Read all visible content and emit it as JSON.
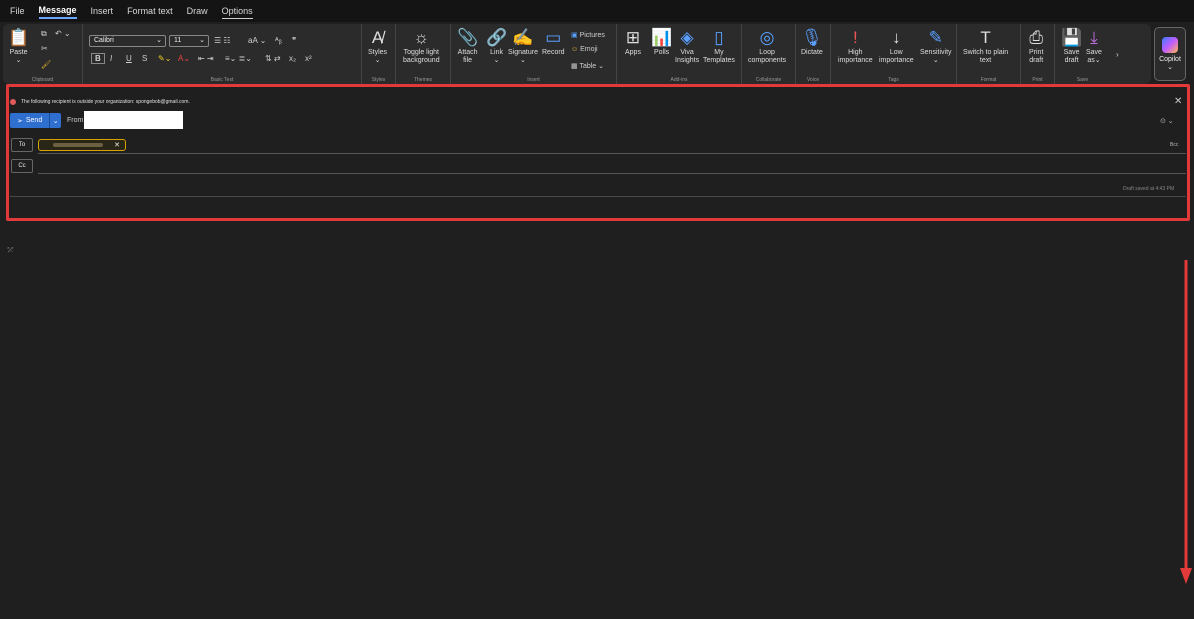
{
  "menu": [
    "File",
    "Message",
    "Insert",
    "Format text",
    "Draw",
    "Options"
  ],
  "ribbon": {
    "clipboard": {
      "paste": "Paste",
      "group": "Clipboard"
    },
    "basic_text": {
      "font": "Calibri",
      "size": "11",
      "group": "Basic Text"
    },
    "styles": {
      "label": "Styles",
      "group": "Styles"
    },
    "toggle": {
      "label1": "Toggle light",
      "label2": "background",
      "group": "Themes"
    },
    "include": {
      "attach1": "Attach",
      "attach2": "file",
      "link": "Link",
      "signature": "Signature",
      "record": "Record",
      "pictures": "Pictures",
      "emoji": "Emoji",
      "table": "Table",
      "group": "Insert"
    },
    "addins": {
      "apps": "Apps",
      "polls": "Polls",
      "viva1": "Viva",
      "viva2": "Insights",
      "my1": "My",
      "my2": "Templates",
      "group": "Add-ins"
    },
    "loop": {
      "label1": "Loop",
      "label2": "components",
      "group": "Collaborate"
    },
    "dictate": {
      "label": "Dictate",
      "group": "Voice"
    },
    "tags": {
      "high1": "High",
      "high2": "importance",
      "low1": "Low",
      "low2": "importance",
      "sens": "Sensitivity",
      "group": "Tags"
    },
    "format": {
      "label1": "Switch to plain",
      "label2": "text",
      "group": "Format"
    },
    "print": {
      "label1": "Print",
      "label2": "draft",
      "group": "Print"
    },
    "save": {
      "save1": "Save",
      "save2": "draft",
      "saveas1": "Save",
      "saveas2": "as",
      "group": "Save"
    },
    "copilot": "Copilot"
  },
  "compose": {
    "warning": "The following recipient is outside your organization: spongebob@gmail.com.",
    "send": "Send",
    "from": "From",
    "to": "To",
    "cc": "Cc",
    "bcc": "Bcc",
    "draft_saved": "Draft saved at 4:43 PM"
  },
  "colors": {
    "highlight": "#e23a3a",
    "accent": "#2f6fd0",
    "chip_border": "#d8a200"
  }
}
